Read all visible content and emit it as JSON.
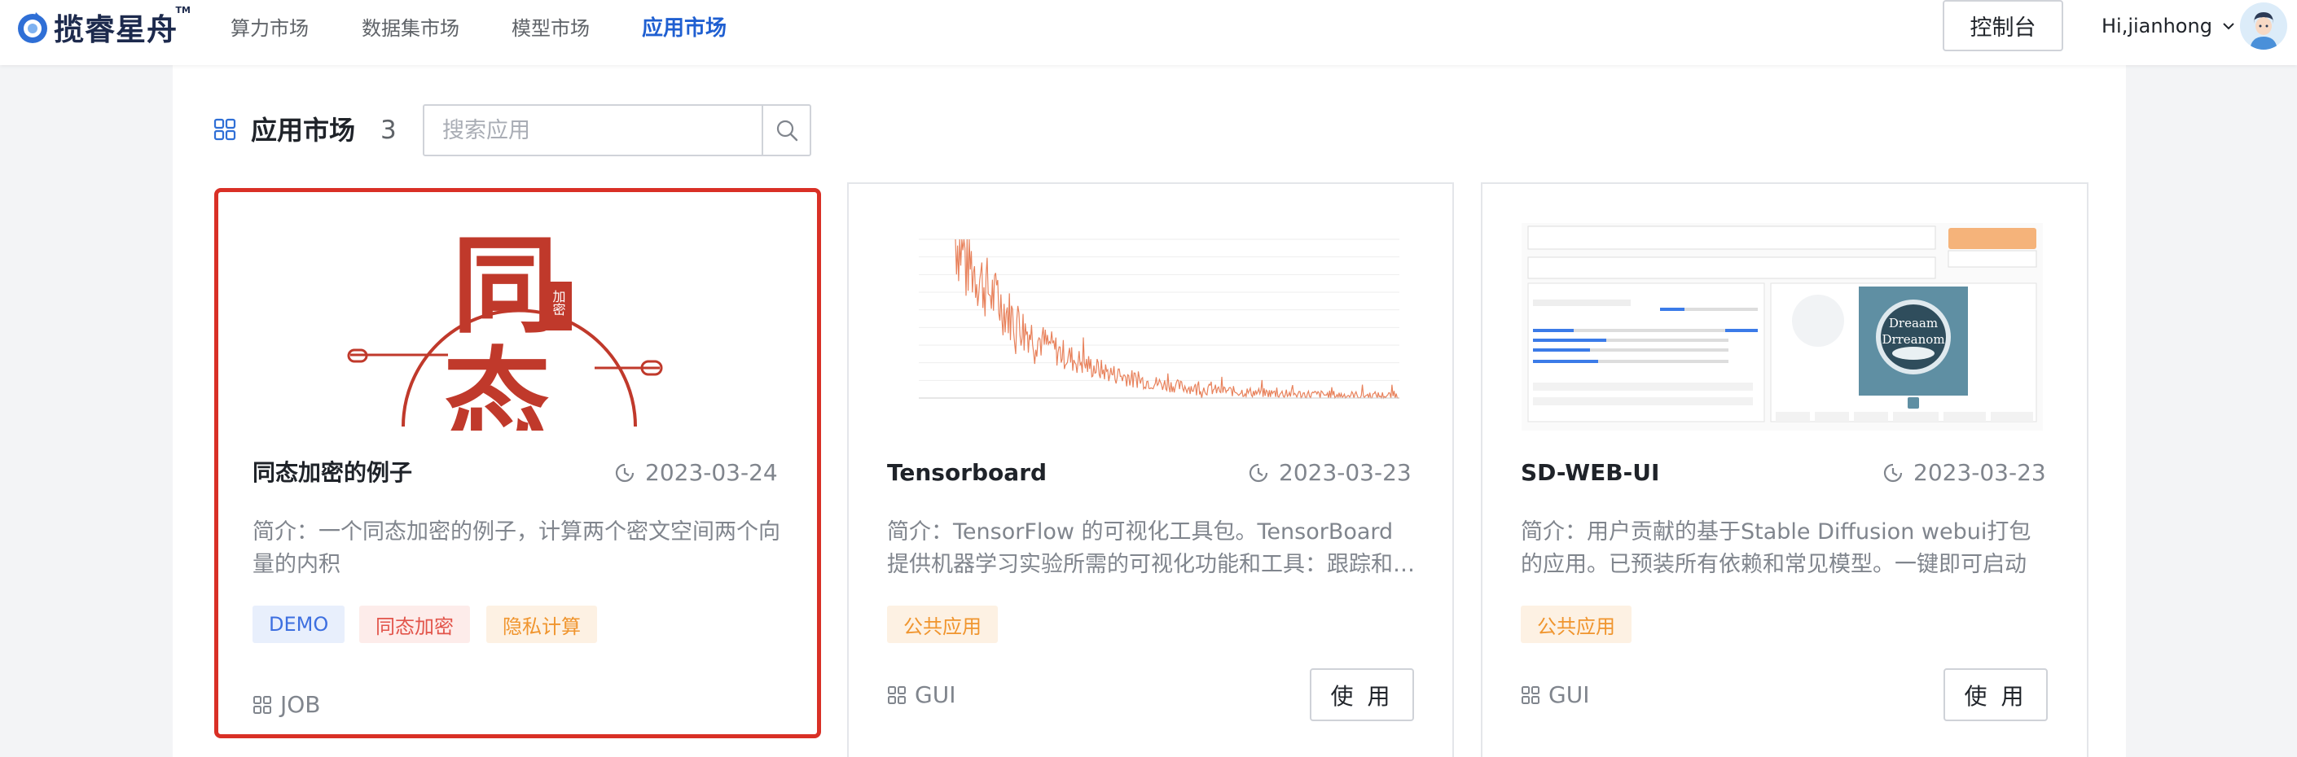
{
  "brand": {
    "name": "揽睿星舟",
    "tm": "TM"
  },
  "nav": [
    {
      "label": "算力市场",
      "active": false
    },
    {
      "label": "数据集市场",
      "active": false
    },
    {
      "label": "模型市场",
      "active": false
    },
    {
      "label": "应用市场",
      "active": true
    }
  ],
  "header": {
    "console_label": "控制台",
    "user_greeting": "Hi,jianhong"
  },
  "section": {
    "title": "应用市场",
    "count": "3"
  },
  "search": {
    "placeholder": "搜索应用",
    "value": ""
  },
  "cards": [
    {
      "title": "同态加密的例子",
      "date": "2023-03-24",
      "description": "简介：一个同态加密的例子，计算两个密文空间两个向量的内积",
      "tags": [
        "DEMO",
        "同态加密",
        "隐私计算"
      ],
      "type": "JOB",
      "selected": true,
      "thumb_text": {
        "big1": "同",
        "big2": "态",
        "seal": "加密"
      }
    },
    {
      "title": "Tensorboard",
      "date": "2023-03-23",
      "description": "简介：TensorFlow 的可视化工具包。TensorBoard 提供机器学习实验所需的可视化功能和工具：跟踪和可视化损失及准确率等指标",
      "tags": [
        "公共应用"
      ],
      "type": "GUI",
      "use_label": "使 用"
    },
    {
      "title": "SD-WEB-UI",
      "date": "2023-03-23",
      "description": "简介：用户贡献的基于Stable Diffusion webui打包的应用。已预装所有依赖和常见模型。一键即可启动",
      "tags": [
        "公共应用"
      ],
      "type": "GUI",
      "use_label": "使 用",
      "thumb_text": {
        "line1": "Dreaam",
        "line2": "Drreanom"
      }
    }
  ],
  "colors": {
    "accent": "#1f5fd1",
    "selected_border": "#d93026",
    "seal_red": "#c0392b",
    "chart_line": "#e8825c"
  }
}
